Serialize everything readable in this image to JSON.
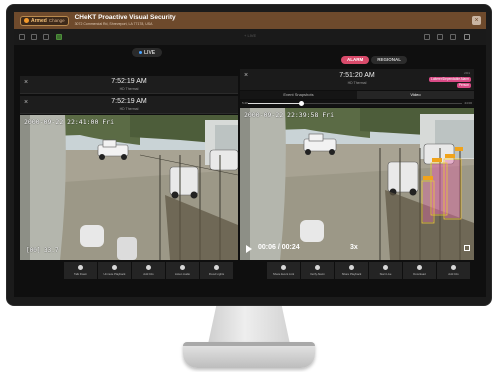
{
  "header": {
    "armed_label": "Armed",
    "armed_change": "Change",
    "site_name": "CHeKT Proactive Visual Security",
    "site_address": "3072 Commercial Rd, Shreveport, LA 77178, USA",
    "close_glyph": "×"
  },
  "toolbar": {
    "live_hint": "+ LIVE"
  },
  "live_panel": {
    "live_label": "LIVE",
    "cameras": [
      {
        "close_glyph": "×",
        "time": "7:52:19 AM",
        "subtitle": "HD Thermal"
      },
      {
        "close_glyph": "×",
        "time": "7:52:19 AM",
        "subtitle": "HD Thermal",
        "osd_timestamp": "2000-09-22 22:41:00 Fri",
        "osd_channel": "[00] 33.7"
      }
    ],
    "controls": [
      {
        "icon": "mic-icon",
        "label": "Talk Down"
      },
      {
        "icon": "refresh-icon",
        "label": "Unmute Playback"
      },
      {
        "icon": "info-icon",
        "label": "Add Info"
      },
      {
        "icon": "speaker-icon",
        "label": "Listen Audio"
      },
      {
        "icon": "light-icon",
        "label": "Flood Lights"
      }
    ]
  },
  "alarm_panel": {
    "tab_alarm": "ALARM",
    "tab_regional": "REGIONAL",
    "close_glyph": "×",
    "time": "7:51:20 AM",
    "subtitle": "HD Thermal",
    "date_text": "2/01",
    "tags": [
      "Loiterer/Dependable Alarm",
      "Person"
    ],
    "subtabs": [
      {
        "label": "Event Snapshots",
        "active": false
      },
      {
        "label": "Video",
        "active": true
      }
    ],
    "scrub_start": "5:28",
    "scrub_end": "24:00",
    "scrub_progress": 0.25,
    "osd_timestamp": "2000-09-22 22:39:58 Fri",
    "playback_time": "00:06 / 00:24",
    "playback_speed": "3x",
    "controls": [
      {
        "icon": "share-icon",
        "label": "Share Event Link"
      },
      {
        "icon": "alarm-icon",
        "label": "Verify Alarm"
      },
      {
        "icon": "refresh-icon",
        "label": "Share Playback"
      },
      {
        "icon": "talk-icon",
        "label": "Start Live"
      },
      {
        "icon": "download-icon",
        "label": "Download"
      },
      {
        "icon": "info-icon",
        "label": "Add Info"
      }
    ]
  }
}
